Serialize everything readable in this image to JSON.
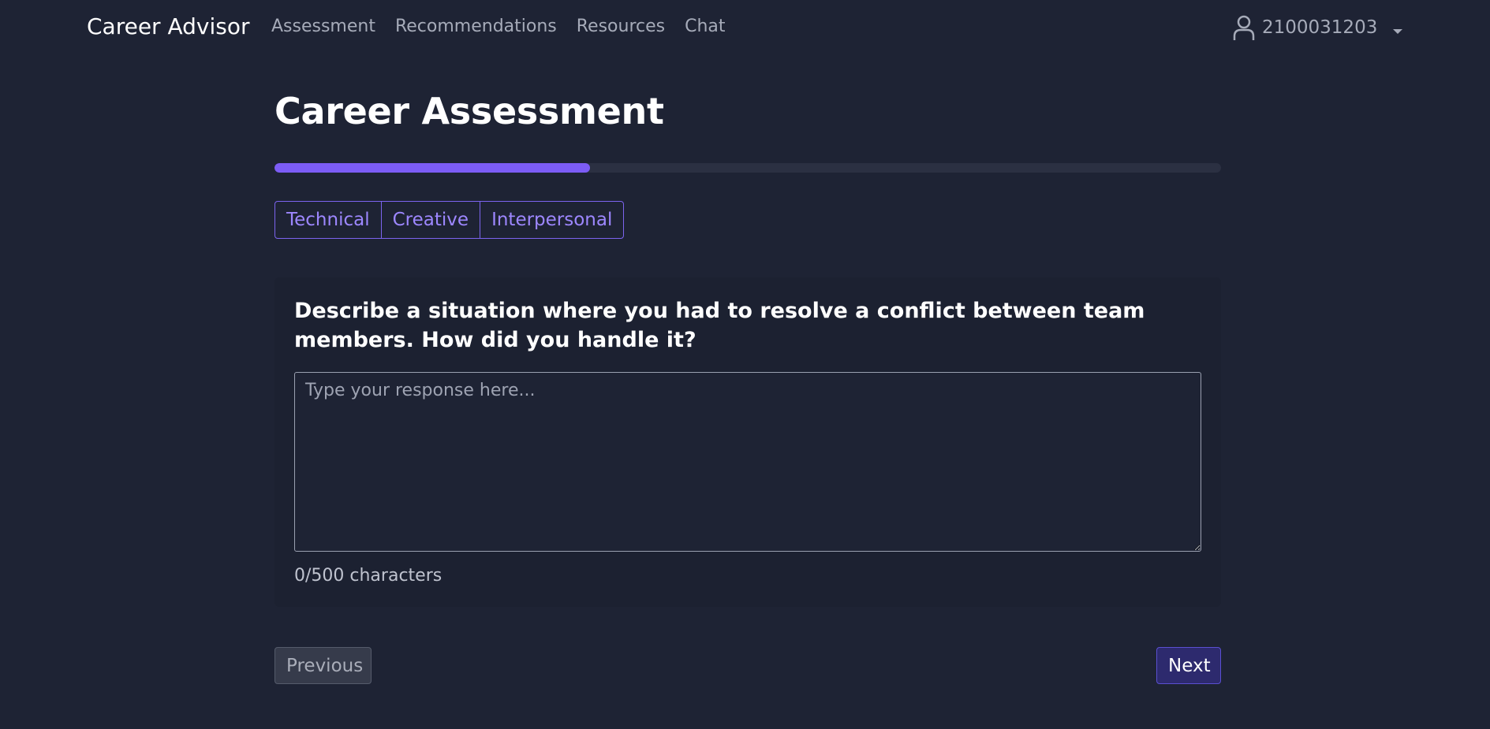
{
  "nav": {
    "brand": "Career Advisor",
    "links": [
      "Assessment",
      "Recommendations",
      "Resources",
      "Chat"
    ],
    "user": {
      "name": "2100031203",
      "icon": "user-icon",
      "menu_icon": "caret-down-icon"
    }
  },
  "assessment": {
    "title": "Career Assessment",
    "progress_percent": 33.3,
    "tabs": [
      "Technical",
      "Creative",
      "Interpersonal"
    ],
    "question": "Describe a situation where you had to resolve a conflict between team members. How did you handle it?",
    "response": {
      "value": "",
      "placeholder": "Type your response here..."
    },
    "char_count": "0/500 characters"
  },
  "actions": {
    "previous": "Previous",
    "next": "Next"
  },
  "colors": {
    "background": "#1e2334",
    "accent": "#7c5cf5",
    "tab_text": "#9d87ff",
    "next_button": "#2d2a6e"
  }
}
